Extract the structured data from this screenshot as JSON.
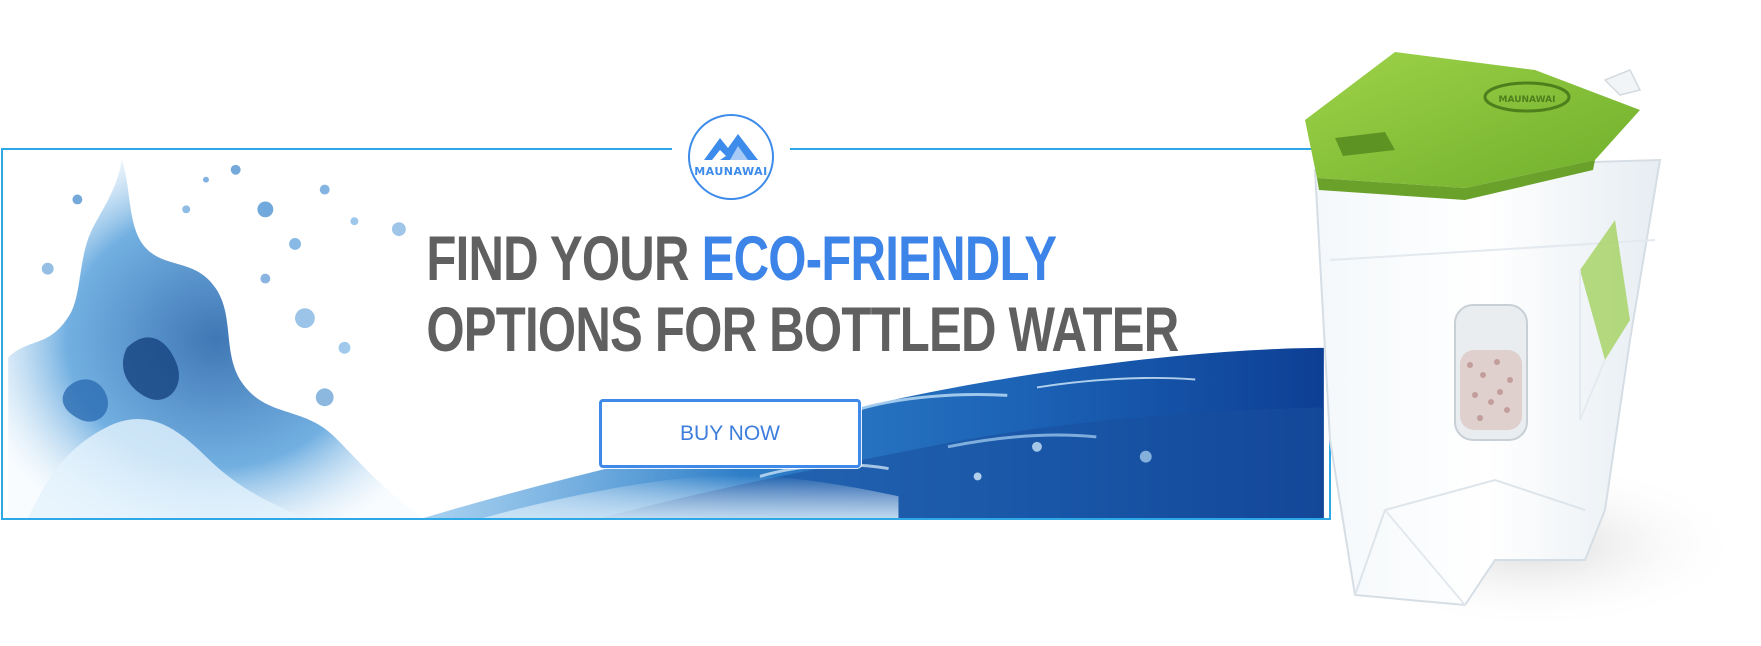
{
  "brand": {
    "logo_text": "MAUNAWAI",
    "lid_logo_text": "MAUNAWAI"
  },
  "headline": {
    "line1_part1": "FIND YOUR ",
    "line1_accent": "ECO-FRIENDLY",
    "line2": "OPTIONS FOR BOTTLED WATER"
  },
  "cta": {
    "label": "BUY NOW"
  },
  "colors": {
    "headline_gray": "#606060",
    "accent_blue": "#3d84e8",
    "frame_blue": "#2ea7e6",
    "pitcher_lid_green": "#8cc63f"
  },
  "icons": {
    "logo": "mountain-logo-icon",
    "water": "water-splash-image",
    "product": "water-filter-pitcher-image"
  }
}
